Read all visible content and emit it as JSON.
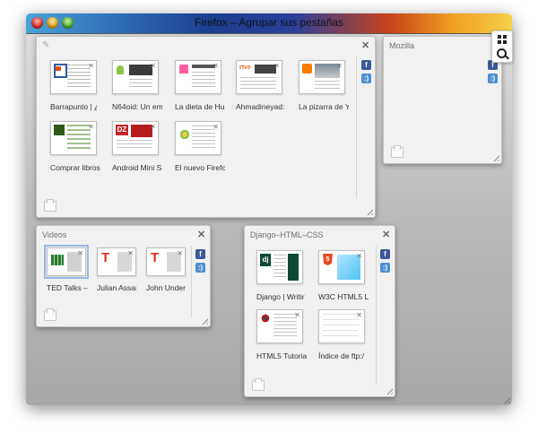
{
  "window": {
    "title": "Firefox – Agrupar sus pestañas"
  },
  "groups": {
    "main": {
      "title": "",
      "tabs": [
        {
          "label": "Barrapunto | ¿",
          "icon": "barrapunto-icon"
        },
        {
          "label": "N64oid: Un em",
          "icon": "android-icon"
        },
        {
          "label": "La dieta de Hu",
          "icon": "pink-square-icon"
        },
        {
          "label": "Ahmadineyad:",
          "icon": "rtve-icon"
        },
        {
          "label": "La pizarra de Y",
          "icon": "blogger-icon"
        },
        {
          "label": "Comprar libros",
          "icon": "book-icon"
        },
        {
          "label": "Android Mini S",
          "icon": "dz-icon"
        },
        {
          "label": "El nuevo Firefc",
          "icon": "flower-icon"
        }
      ]
    },
    "mozilla": {
      "title": "Mozilla",
      "tabs": []
    },
    "videos": {
      "title": "Videos",
      "tabs": [
        {
          "label": "TED Talks –",
          "icon": "ted-grid-icon"
        },
        {
          "label": "Julian Assan",
          "icon": "ted-t-icon"
        },
        {
          "label": "John Underk",
          "icon": "ted-t-icon"
        }
      ]
    },
    "django": {
      "title": "Django–HTML–CSS",
      "tabs": [
        {
          "label": "Django | Writir",
          "icon": "django-icon"
        },
        {
          "label": "W3C HTML5 Lo",
          "icon": "html5-icon"
        },
        {
          "label": "HTML5 Tutoria",
          "icon": "camera-icon"
        },
        {
          "label": "Índice de ftp:/",
          "icon": "blank-page-icon"
        }
      ]
    }
  },
  "app_icons": {
    "facebook": "f",
    "smile": ":)"
  },
  "colors": {
    "facebook": "#3b5998",
    "smile": "#4c8fd0"
  }
}
